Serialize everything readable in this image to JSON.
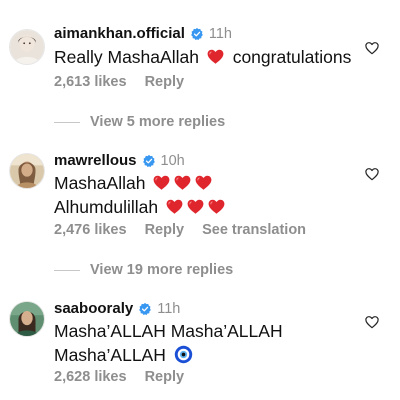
{
  "colors": {
    "muted": "#8e8e8e",
    "verified": "#3897f0",
    "heart": "#e0262d"
  },
  "comments": [
    {
      "username": "aimankhan.official",
      "time": "11h",
      "text_before": "Really MashaAllah",
      "text_after": "congratulations",
      "likes": "2,613 likes",
      "reply": "Reply"
    },
    {
      "username": "mawrellous",
      "time": "10h",
      "line1": "MashaAllah",
      "line2": "Alhumdulillah",
      "likes": "2,476 likes",
      "reply": "Reply",
      "translation": "See translation"
    },
    {
      "username": "saabooraly",
      "time": "11h",
      "line1": "Masha’ALLAH Masha’ALLAH",
      "line2": "Masha’ALLAH",
      "likes": "2,628 likes",
      "reply": "Reply"
    }
  ],
  "view_replies": [
    {
      "label": "View 5 more replies"
    },
    {
      "label": "View 19 more replies"
    }
  ]
}
